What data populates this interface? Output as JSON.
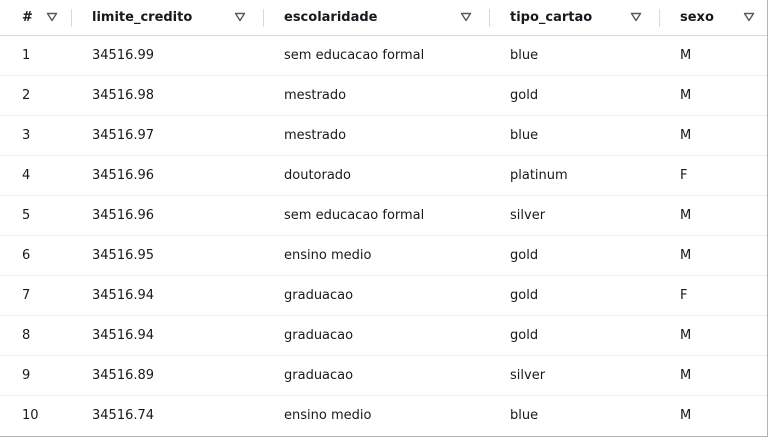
{
  "table": {
    "columns": [
      {
        "label": "#"
      },
      {
        "label": "limite_credito"
      },
      {
        "label": "escolaridade"
      },
      {
        "label": "tipo_cartao"
      },
      {
        "label": "sexo"
      }
    ],
    "rows": [
      [
        "1",
        "34516.99",
        "sem educacao formal",
        "blue",
        "M"
      ],
      [
        "2",
        "34516.98",
        "mestrado",
        "gold",
        "M"
      ],
      [
        "3",
        "34516.97",
        "mestrado",
        "blue",
        "M"
      ],
      [
        "4",
        "34516.96",
        "doutorado",
        "platinum",
        "F"
      ],
      [
        "5",
        "34516.96",
        "sem educacao formal",
        "silver",
        "M"
      ],
      [
        "6",
        "34516.95",
        "ensino medio",
        "gold",
        "M"
      ],
      [
        "7",
        "34516.94",
        "graduacao",
        "gold",
        "F"
      ],
      [
        "8",
        "34516.94",
        "graduacao",
        "gold",
        "M"
      ],
      [
        "9",
        "34516.89",
        "graduacao",
        "silver",
        "M"
      ],
      [
        "10",
        "34516.74",
        "ensino medio",
        "blue",
        "M"
      ]
    ]
  },
  "icons": {
    "sort": "sort-caret-down-icon"
  },
  "colors": {
    "text": "#16191f",
    "icon": "#545b64",
    "row_divider": "#eaeded",
    "header_divider": "#d5dbdb"
  }
}
